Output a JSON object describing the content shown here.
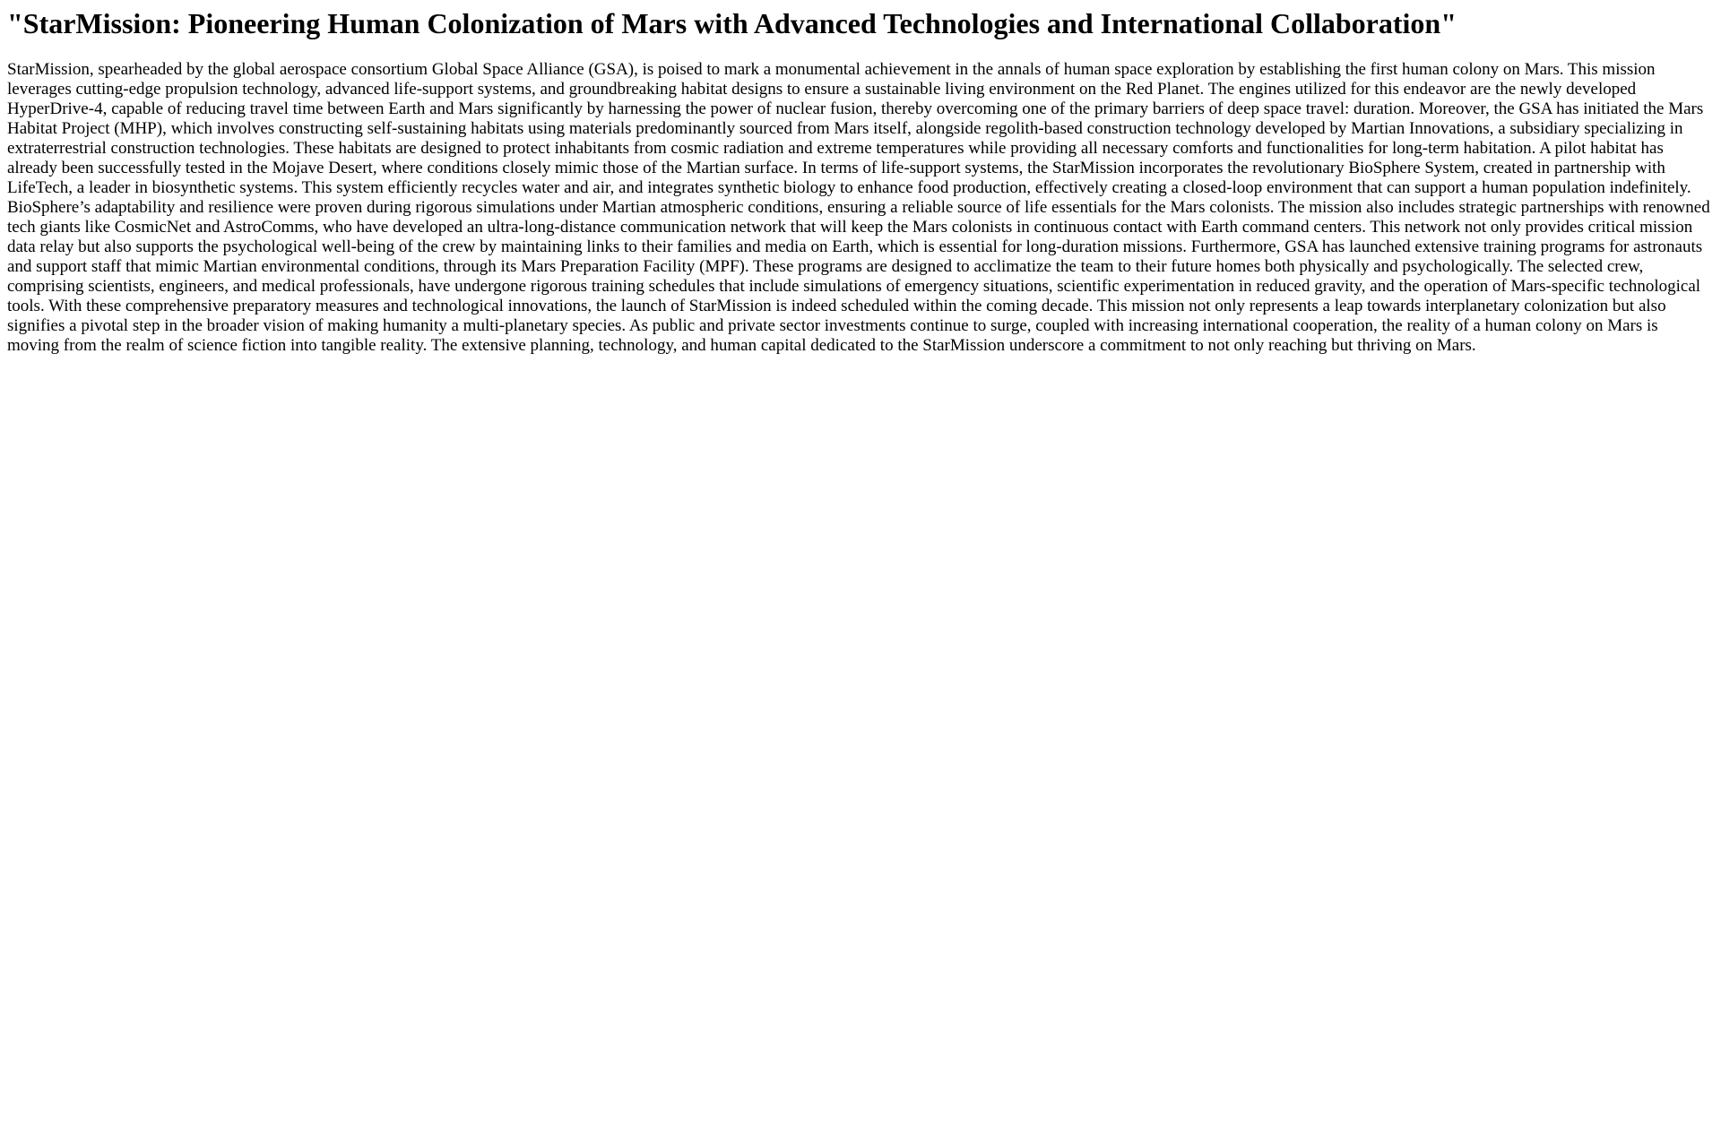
{
  "page": {
    "title": "\"StarMission: Pioneering Human Colonization of Mars with Advanced Technologies and International Collaboration\"",
    "body": "StarMission, spearheaded by the global aerospace consortium Global Space Alliance (GSA), is poised to mark a monumental achievement in the annals of human space exploration by establishing the first human colony on Mars. This mission leverages cutting-edge propulsion technology, advanced life-support systems, and groundbreaking habitat designs to ensure a sustainable living environment on the Red Planet. The engines utilized for this endeavor are the newly developed HyperDrive-4, capable of reducing travel time between Earth and Mars significantly by harnessing the power of nuclear fusion, thereby overcoming one of the primary barriers of deep space travel: duration. Moreover, the GSA has initiated the Mars Habitat Project (MHP), which involves constructing self-sustaining habitats using materials predominantly sourced from Mars itself, alongside regolith-based construction technology developed by Martian Innovations, a subsidiary specializing in extraterrestrial construction technologies. These habitats are designed to protect inhabitants from cosmic radiation and extreme temperatures while providing all necessary comforts and functionalities for long-term habitation. A pilot habitat has already been successfully tested in the Mojave Desert, where conditions closely mimic those of the Martian surface. In terms of life-support systems, the StarMission incorporates the revolutionary BioSphere System, created in partnership with LifeTech, a leader in biosynthetic systems. This system efficiently recycles water and air, and integrates synthetic biology to enhance food production, effectively creating a closed-loop environment that can support a human population indefinitely. BioSphere’s adaptability and resilience were proven during rigorous simulations under Martian atmospheric conditions, ensuring a reliable source of life essentials for the Mars colonists. The mission also includes strategic partnerships with renowned tech giants like CosmicNet and AstroComms, who have developed an ultra-long-distance communication network that will keep the Mars colonists in continuous contact with Earth command centers. This network not only provides critical mission data relay but also supports the psychological well-being of the crew by maintaining links to their families and media on Earth, which is essential for long-duration missions. Furthermore, GSA has launched extensive training programs for astronauts and support staff that mimic Martian environmental conditions, through its Mars Preparation Facility (MPF). These programs are designed to acclimatize the team to their future homes both physically and psychologically. The selected crew, comprising scientists, engineers, and medical professionals, have undergone rigorous training schedules that include simulations of emergency situations, scientific experimentation in reduced gravity, and the operation of Mars-specific technological tools. With these comprehensive preparatory measures and technological innovations, the launch of StarMission is indeed scheduled within the coming decade. This mission not only represents a leap towards interplanetary colonization but also signifies a pivotal step in the broader vision of making humanity a multi-planetary species. As public and private sector investments continue to surge, coupled with increasing international cooperation, the reality of a human colony on Mars is moving from the realm of science fiction into tangible reality. The extensive planning, technology, and human capital dedicated to the StarMission underscore a commitment to not only reaching but thriving on Mars."
  }
}
